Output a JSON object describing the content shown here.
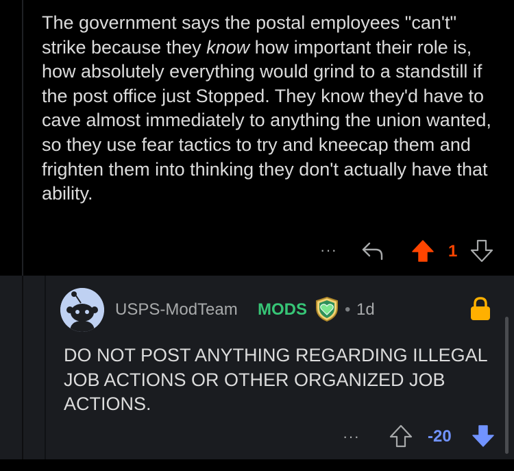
{
  "parent": {
    "body_before_emphasis": "The government says the postal employees \"can't\" strike because they ",
    "body_emphasis": "know",
    "body_after_emphasis": " how important their role is, how absolutely everything would grind to a standstill if the post office just Stopped. They know they'd have to cave almost immediately to anything the union wanted, so they use fear tactics to try and kneecap them and frighten them into thinking they don't actually have that ability.",
    "more_label": "···",
    "score": "1",
    "upvoted": true,
    "upvote_color": "#ff4500"
  },
  "reply": {
    "author": "USPS-ModTeam",
    "flair": "MODS",
    "flair_color": "#37c576",
    "separator": "•",
    "timestamp": "1d",
    "body": "DO NOT POST ANYTHING REGARDING ILLEGAL JOB ACTIONS OR OTHER ORGANIZED JOB ACTIONS.",
    "more_label": "···",
    "score": "-20",
    "downvoted": true,
    "downvote_color": "#7193ff",
    "locked": true,
    "lock_color": "#ffb000"
  },
  "icons": {
    "reply": "reply-arrow-icon",
    "upvote": "upvote-arrow-icon",
    "downvote": "downvote-arrow-icon",
    "lock": "lock-icon",
    "badge": "mod-shield-heart-icon",
    "avatar": "snoo-avatar-icon"
  }
}
